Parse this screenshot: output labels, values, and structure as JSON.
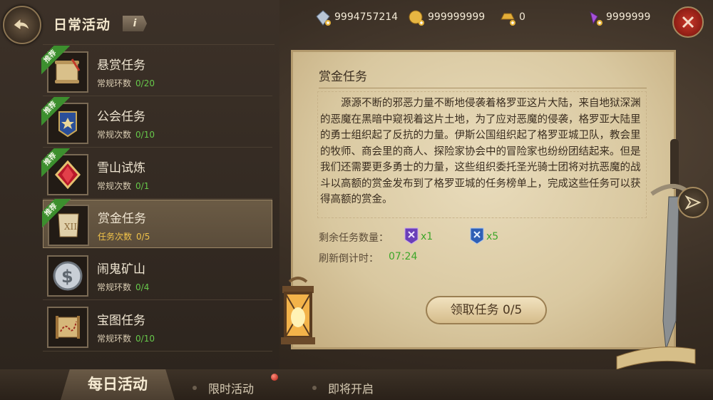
{
  "panel": {
    "title": "日常活动",
    "info_label": "i"
  },
  "currencies": [
    {
      "icon": "diamond-plus-icon",
      "value": "9994757214"
    },
    {
      "icon": "gold-coin-plus-icon",
      "value": "999999999"
    },
    {
      "icon": "gold-ingot-plus-icon",
      "value": "0"
    },
    {
      "icon": "purple-crystal-plus-icon",
      "value": "9999999"
    }
  ],
  "tasks": [
    {
      "name": "悬赏任务",
      "progress_label": "常规环数",
      "progress": "0/20",
      "recommended": true,
      "icon": "scroll-quill-icon"
    },
    {
      "name": "公会任务",
      "progress_label": "常规次数",
      "progress": "0/10",
      "recommended": true,
      "icon": "guild-banner-icon"
    },
    {
      "name": "雪山试炼",
      "progress_label": "常规次数",
      "progress": "0/1",
      "recommended": true,
      "icon": "red-gem-icon"
    },
    {
      "name": "赏金任务",
      "progress_label": "任务次数",
      "progress": "0/5",
      "recommended": true,
      "selected": true,
      "icon": "bounty-scroll-icon"
    },
    {
      "name": "闹鬼矿山",
      "progress_label": "常规环数",
      "progress": "0/4",
      "recommended": false,
      "icon": "silver-coin-icon"
    },
    {
      "name": "宝图任务",
      "progress_label": "常规环数",
      "progress": "0/10",
      "recommended": false,
      "icon": "treasure-map-icon"
    }
  ],
  "recommended_label": "推荐",
  "detail": {
    "title": "赏金任务",
    "description": "源源不断的邪恶力量不断地侵袭着格罗亚这片大陆，来自地狱深渊的恶魔在黑暗中窥视着这片土地，为了应对恶魔的侵袭，格罗亚大陆里的勇士组织起了反抗的力量。伊斯公国组织起了格罗亚城卫队，教会里的牧师、商会里的商人、探险家协会中的冒险家也纷纷团结起来。但是我们还需要更多勇士的力量，这些组织委托圣光骑士团将对抗恶魔的战斗以高额的赏金发布到了格罗亚城的任务榜单上，完成这些任务可以获得高额的赏金。",
    "remaining_label": "剩余任务数量：",
    "rewards": [
      {
        "icon": "purple-bounty-badge-icon",
        "count": "x1"
      },
      {
        "icon": "blue-bounty-badge-icon",
        "count": "x5"
      }
    ],
    "refresh_label": "刷新倒计时：",
    "refresh_time": "07:24",
    "claim_button": "领取任务  0/5"
  },
  "bottom_tabs": {
    "daily": "每日活动",
    "limited": "限时活动",
    "coming": "即将开启"
  }
}
